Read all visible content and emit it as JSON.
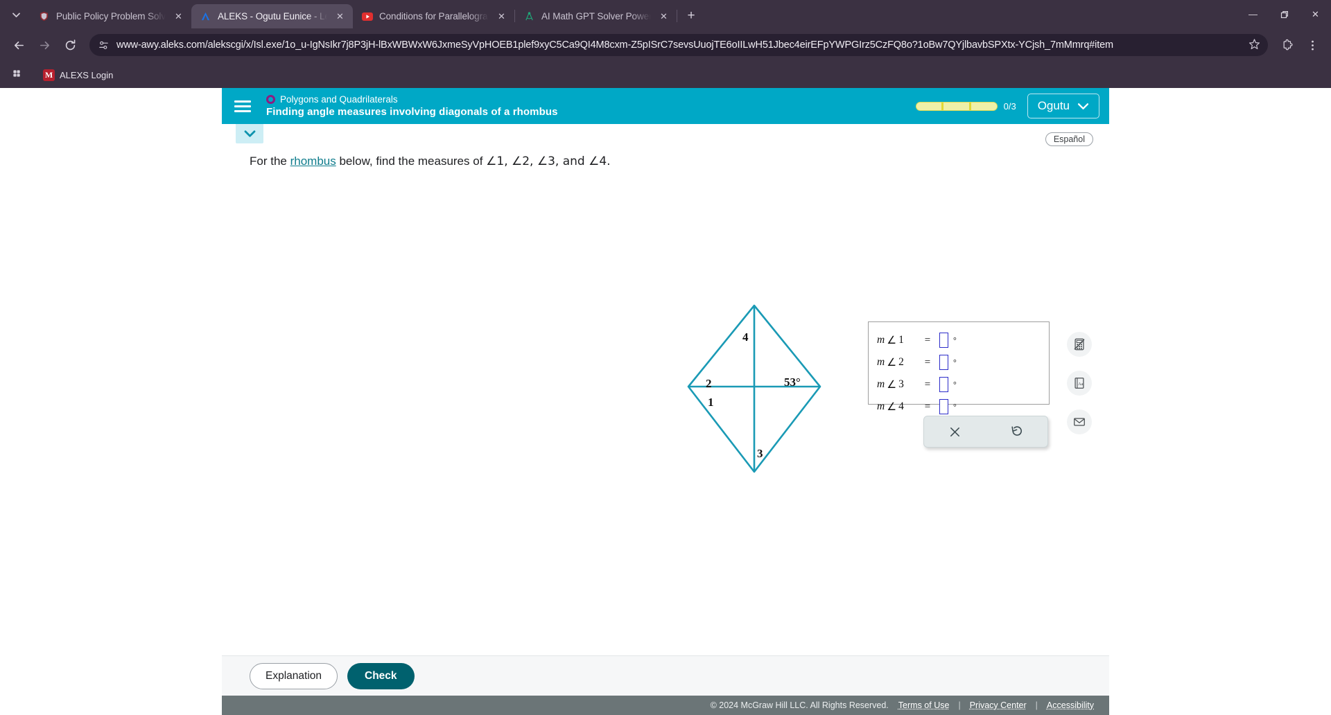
{
  "browser": {
    "tab_list_icon": "chevron-down-icon",
    "tabs": [
      {
        "title": "Public Policy Problem Solving",
        "favicon": "shield-icon",
        "active": false,
        "close_label": "✕"
      },
      {
        "title": "ALEKS - Ogutu Eunice - Learn",
        "favicon": "aleks-a-icon",
        "active": true,
        "close_label": "✕"
      },
      {
        "title": "Conditions for Parallelograms",
        "favicon": "youtube-icon",
        "active": false,
        "close_label": "✕"
      },
      {
        "title": "AI Math GPT Solver Powered by",
        "favicon": "compass-icon",
        "active": false,
        "close_label": "✕"
      }
    ],
    "new_tab_label": "+",
    "window_controls": {
      "minimize": "—",
      "restore": "❐",
      "close": "✕"
    },
    "nav": {
      "back": "←",
      "forward": "→",
      "reload": "⟳"
    },
    "omnibox": {
      "site_settings_icon": "tune-icon",
      "url": "www-awy.aleks.com/alekscgi/x/Isl.exe/1o_u-IgNsIkr7j8P3jH-lBxWBWxW6JxmeSyVpHOEB1plef9xyC5Ca9QI4M8cxm-Z5pISrC7sevsUuojTE6oIILwH51Jbec4eirEFpYWPGIrz5CzFQ8o?1oBw7QYjlbavbSPXtx-YCjsh_7mMmrq#item",
      "bookmark_icon": "star-icon"
    },
    "toolbar_right": {
      "extensions": "puzzle-icon",
      "menu": "kebab-menu-icon"
    },
    "bookmarks": {
      "apps_icon": "apps-grid-icon",
      "items": [
        {
          "label": "ALEXS Login",
          "favicon_letter": "M"
        }
      ]
    }
  },
  "aleks": {
    "header": {
      "menu_icon": "hamburger-icon",
      "topic": "Polygons and Quadrilaterals",
      "title": "Finding angle measures involving diagonals of a rhombus",
      "progress": {
        "count_label": "0/3",
        "segments": 3,
        "filled": 0
      },
      "user": {
        "name": "Ogutu",
        "caret": "❯"
      }
    },
    "content": {
      "collapse_icon": "chevron-down-icon",
      "language_button": "Español",
      "question": {
        "prefix": "For the ",
        "link": "rhombus",
        "suffix": " below, find the measures of ",
        "angles": "∠1, ∠2, ∠3, and ∠4.",
        "full": "For the rhombus below, find the measures of ∠1, ∠2, ∠3, and ∠4."
      },
      "figure": {
        "name": "rhombus-diagram",
        "stroke_color": "#1a9ab5",
        "labels": [
          {
            "id": "label-4",
            "text": "4"
          },
          {
            "id": "label-2",
            "text": "2"
          },
          {
            "id": "label-1",
            "text": "1"
          },
          {
            "id": "label-3",
            "text": "3"
          },
          {
            "id": "label-53",
            "text": "53°"
          }
        ]
      },
      "answers": {
        "rows": [
          {
            "label_m": "m",
            "angle": "∠",
            "num": "1",
            "equals": "=",
            "value": "",
            "unit": "°"
          },
          {
            "label_m": "m",
            "angle": "∠",
            "num": "2",
            "equals": "=",
            "value": "",
            "unit": "°"
          },
          {
            "label_m": "m",
            "angle": "∠",
            "num": "3",
            "equals": "=",
            "value": "",
            "unit": "°"
          },
          {
            "label_m": "m",
            "angle": "∠",
            "num": "4",
            "equals": "=",
            "value": "",
            "unit": "°"
          }
        ]
      },
      "mini_toolbar": [
        {
          "id": "clear-button",
          "icon": "close-x-icon",
          "glyph": "✕"
        },
        {
          "id": "undo-button",
          "icon": "undo-icon",
          "glyph": "↺"
        }
      ],
      "right_tools": [
        {
          "id": "calculator-button",
          "icon": "calculator-disabled-icon"
        },
        {
          "id": "glossary-button",
          "icon": "book-aa-icon"
        },
        {
          "id": "message-button",
          "icon": "envelope-icon"
        }
      ]
    },
    "actions": {
      "explanation_label": "Explanation",
      "check_label": "Check"
    },
    "footer": {
      "copyright": "© 2024 McGraw Hill LLC. All Rights Reserved.",
      "links": [
        "Terms of Use",
        "Privacy Center",
        "Accessibility"
      ],
      "separator": "|"
    }
  },
  "colors": {
    "aleks_teal": "#00a8c6",
    "check_button": "#00616e",
    "figure_stroke": "#1a9ab5",
    "topic_dot": "#8c1d82",
    "input_border": "#2b2bc9",
    "chrome_bg": "#3b3142"
  }
}
